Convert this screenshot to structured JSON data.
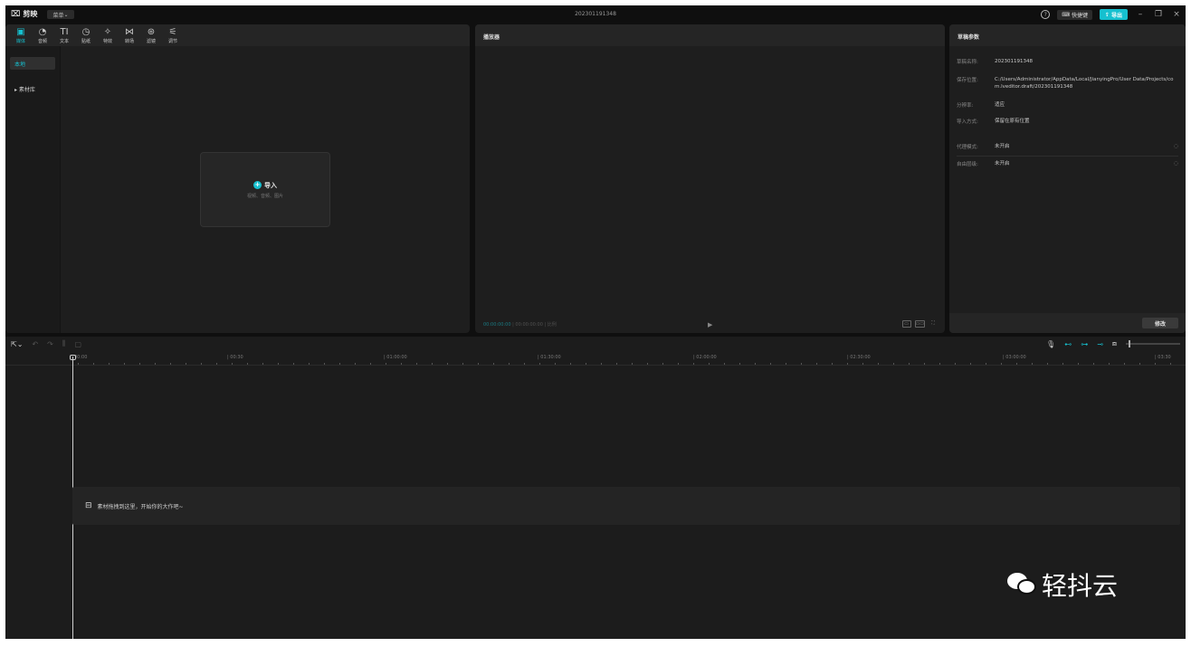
{
  "app": {
    "logo": "剪映",
    "menu_label": "菜单",
    "project_title": "202301191348",
    "help_icon": "?",
    "shortcut_label": "快捷键",
    "export_label": "导出",
    "window_controls": [
      "–",
      "❐",
      "×"
    ]
  },
  "media_panel": {
    "tabs": [
      {
        "icon": "media-icon",
        "glyph": "▣",
        "label": "媒体"
      },
      {
        "icon": "audio-icon",
        "glyph": "◔",
        "label": "音频"
      },
      {
        "icon": "text-icon",
        "glyph": "TI",
        "label": "文本"
      },
      {
        "icon": "sticker-icon",
        "glyph": "◷",
        "label": "贴纸"
      },
      {
        "icon": "effects-icon",
        "glyph": "✧",
        "label": "特效"
      },
      {
        "icon": "transition-icon",
        "glyph": "⋈",
        "label": "转场"
      },
      {
        "icon": "filter-icon",
        "glyph": "⊛",
        "label": "滤镜"
      },
      {
        "icon": "adjust-icon",
        "glyph": "⚟",
        "label": "调节"
      }
    ],
    "side_nav": [
      {
        "label": "本地",
        "active": true
      },
      {
        "label": "▸ 素材库",
        "active": false
      }
    ],
    "import": {
      "label": "导入",
      "sub": "视频、音频、图片"
    }
  },
  "player": {
    "title": "播放器",
    "timecode_current": "00:00:00:00",
    "timecode_total": "00:00:00:00",
    "ratio_label": "比例",
    "controls": [
      "▭",
      "▭▭",
      "⛶"
    ]
  },
  "params": {
    "title": "草稿参数",
    "rows": [
      {
        "key": "草稿名称:",
        "value": "202301191348"
      },
      {
        "key": "保存位置:",
        "value": "C:/Users/Administrator/AppData/Local/JianyingPro/User Data/Projects/com.lveditor.draft/202301191348"
      },
      {
        "key": "分辨率:",
        "value": "适应"
      },
      {
        "key": "导入方式:",
        "value": "保留在原有位置"
      },
      {
        "key": "代理模式:",
        "value": "未开启"
      },
      {
        "key": "自由层级:",
        "value": "未开启"
      }
    ],
    "modify_label": "修改"
  },
  "timeline": {
    "ticks": [
      "00:00",
      "| 00:30",
      "| 01:00:00",
      "| 01:30:00",
      "| 02:00:00",
      "| 02:30:00",
      "| 03:00:00",
      "| 03:30"
    ],
    "drop_hint": "素材拖拽到这里，开始你的大作吧~"
  },
  "watermark": {
    "text": "轻抖云"
  },
  "colors": {
    "accent": "#16c0cf",
    "panel": "#1e1e1e",
    "background": "#0f0f0f"
  }
}
